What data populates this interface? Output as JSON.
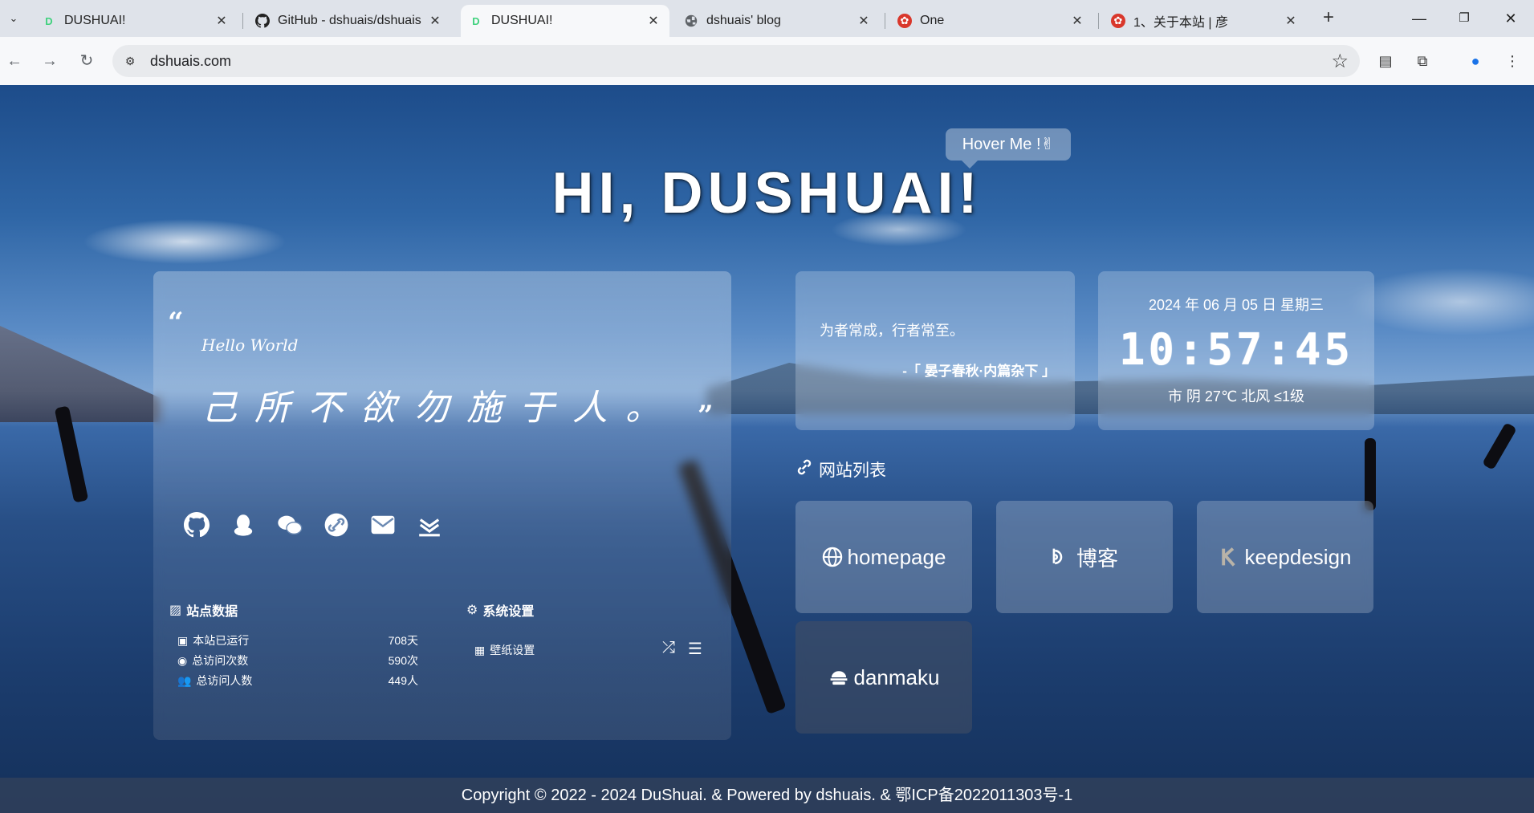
{
  "browser": {
    "tabs": [
      {
        "title": "DUSHUAI!",
        "icon": "d-logo-icon",
        "active": false
      },
      {
        "title": "GitHub - dshuais/dshuais",
        "icon": "github-icon",
        "active": false
      },
      {
        "title": "DUSHUAI!",
        "icon": "d-logo-icon",
        "active": true
      },
      {
        "title": "dshuais' blog",
        "icon": "globe-icon",
        "active": false
      },
      {
        "title": "One",
        "icon": "one-icon",
        "active": false
      },
      {
        "title": "1、关于本站 | 彦",
        "icon": "one-icon",
        "active": false
      }
    ],
    "url": "dshuais.com"
  },
  "hero": {
    "hover_tip": "Hover Me !✌",
    "title": "HI, DUSHUAI!"
  },
  "intro": {
    "hello": "Hello World",
    "motto": "己所不欲勿施于人。",
    "socials": [
      "github-icon",
      "qq-icon",
      "wechat-icon",
      "link-icon",
      "mail-icon",
      "download-icon"
    ]
  },
  "stats": {
    "title": "站点数据",
    "rows": [
      {
        "label": "本站已运行",
        "value": "708天"
      },
      {
        "label": "总访问次数",
        "value": "590次"
      },
      {
        "label": "总访问人数",
        "value": "449人"
      }
    ]
  },
  "settings": {
    "title": "系统设置",
    "wallpaper": "壁纸设置"
  },
  "quote": {
    "text": "为者常成，行者常至。",
    "source": "-「 晏子春秋·内篇杂下 」"
  },
  "clock": {
    "date": "2024 年 06 月 05 日 星期三",
    "time": "10:57:45",
    "weather": "市 阴 27℃ 北风  ≤1级"
  },
  "sites": {
    "title": "网站列表",
    "items": [
      {
        "label": "homepage",
        "icon": "globe-icon"
      },
      {
        "label": "博客",
        "icon": "blog-icon"
      },
      {
        "label": "keepdesign",
        "icon": "k-logo-icon"
      },
      {
        "label": "danmaku",
        "icon": "danmaku-icon"
      }
    ]
  },
  "footer": {
    "text": "Copyright © 2022 - 2024 DuShuai.  &  Powered by dshuais.  &  鄂ICP备2022011303号-1"
  }
}
